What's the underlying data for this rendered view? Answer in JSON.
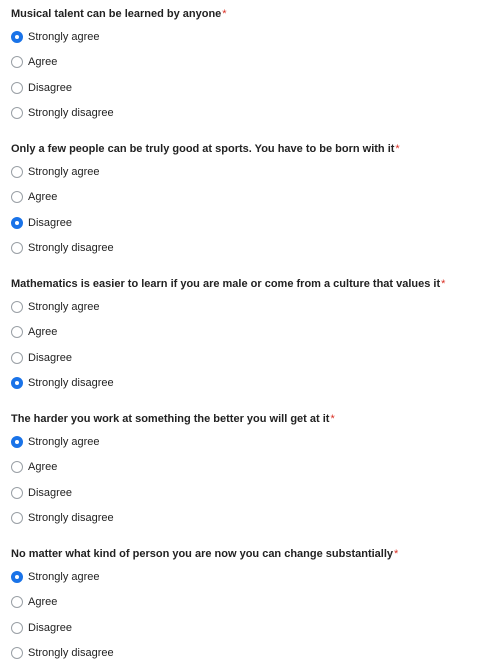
{
  "required_marker": "*",
  "accent_color": "#1a73e8",
  "required_color": "#d93025",
  "questions": [
    {
      "title": "Musical talent can be learned by anyone",
      "options": [
        "Strongly agree",
        "Agree",
        "Disagree",
        "Strongly disagree"
      ],
      "selected": 0
    },
    {
      "title": "Only a few people can be truly good at sports. You have to be born with it",
      "options": [
        "Strongly agree",
        "Agree",
        "Disagree",
        "Strongly disagree"
      ],
      "selected": 2
    },
    {
      "title": "Mathematics is easier to learn if you are male or come from a culture that values it",
      "options": [
        "Strongly agree",
        "Agree",
        "Disagree",
        "Strongly disagree"
      ],
      "selected": 3
    },
    {
      "title": "The harder you work at something the better you will get at it",
      "options": [
        "Strongly agree",
        "Agree",
        "Disagree",
        "Strongly disagree"
      ],
      "selected": 0
    },
    {
      "title": "No matter what kind of person you are now you can change substantially",
      "options": [
        "Strongly agree",
        "Agree",
        "Disagree",
        "Strongly disagree"
      ],
      "selected": 0
    }
  ]
}
